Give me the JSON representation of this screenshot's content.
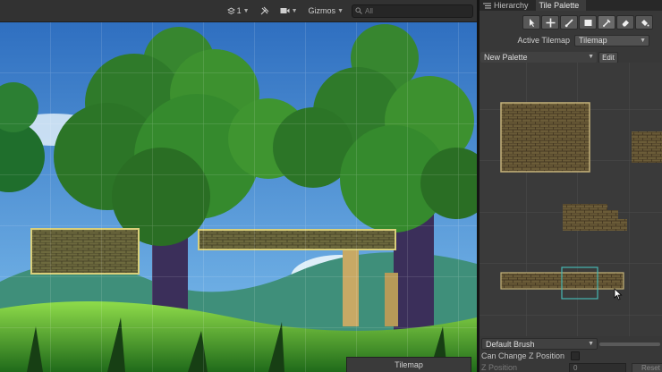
{
  "scene": {
    "toolbar": {
      "layers_count": "1",
      "gizmos_label": "Gizmos",
      "search_placeholder": "All"
    },
    "tilemap_overlay_label": "Tilemap"
  },
  "panel": {
    "tabs": [
      {
        "label": "Hierarchy",
        "active": false
      },
      {
        "label": "Tile Palette",
        "active": true
      }
    ],
    "tools": [
      "select-tool",
      "move-tool",
      "paint-tool",
      "box-fill-tool",
      "picker-tool",
      "erase-tool",
      "fill-tool"
    ],
    "active_tilemap_label": "Active Tilemap",
    "active_tilemap_value": "Tilemap",
    "palette_value": "New Palette",
    "edit_label": "Edit",
    "brush_value": "Default Brush",
    "can_change_z_label": "Can Change Z Position",
    "z_position_label": "Z Position",
    "z_position_value": "0",
    "reset_label": "Reset"
  },
  "colors": {
    "editor_bg": "#383838",
    "sky": "#3f8fd6",
    "foliage": "#2f8a2c",
    "stone": "#8a7a4a",
    "selection": "#46b7b3"
  }
}
